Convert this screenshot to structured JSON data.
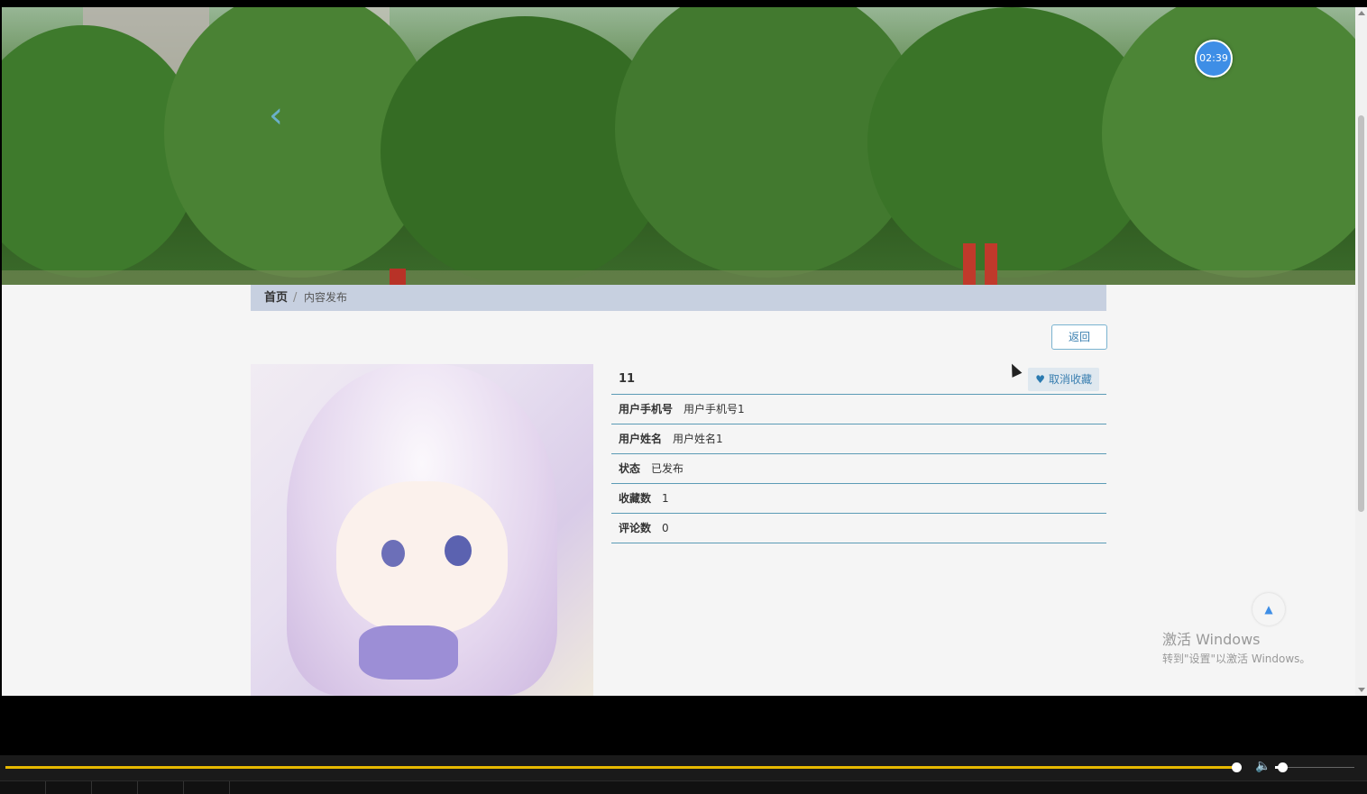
{
  "banner": {
    "prev_icon": "chevron-left-icon",
    "clock_time": "02:39"
  },
  "breadcrumb": {
    "home": "首页",
    "separator": "/",
    "current": "内容发布"
  },
  "actions": {
    "back_label": "返回",
    "unfavorite_label": "取消收藏",
    "unfavorite_icon": "heart-icon"
  },
  "detail": {
    "title": "11",
    "fields": [
      {
        "label": "用户手机号",
        "value": "用户手机号1"
      },
      {
        "label": "用户姓名",
        "value": "用户姓名1"
      },
      {
        "label": "状态",
        "value": "已发布"
      },
      {
        "label": "收藏数",
        "value": "1"
      },
      {
        "label": "评论数",
        "value": "0"
      }
    ]
  },
  "watermark": {
    "line1": "激活 Windows",
    "line2": "转到\"设置\"以激活 Windows。"
  },
  "player": {
    "progress": 0.9,
    "volume": 0.1
  },
  "colors": {
    "accent": "#3e8ee6",
    "breadcrumb_bg": "#c7d0e0",
    "divider": "#5b9bb6",
    "progress": "#e6b800"
  }
}
